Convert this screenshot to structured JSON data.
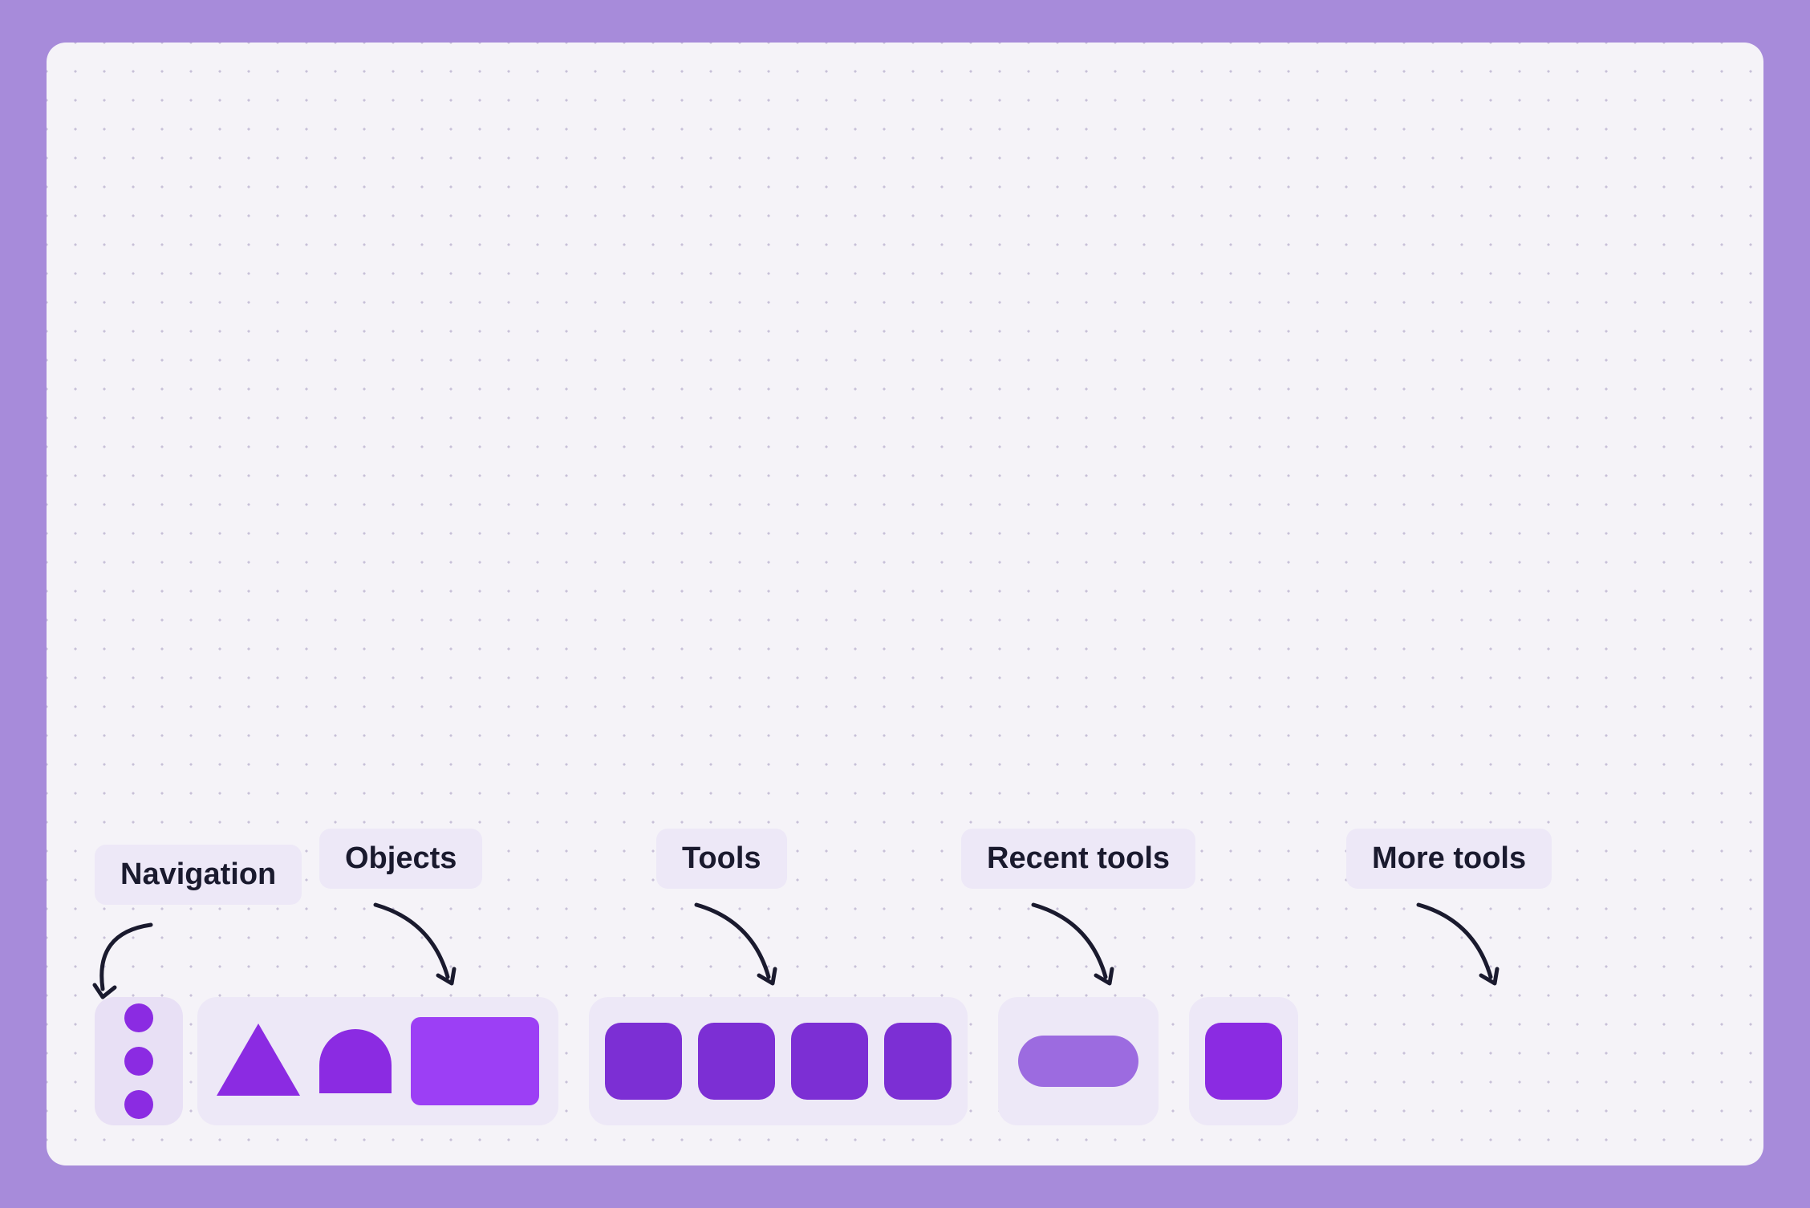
{
  "canvas": {
    "background": "#f5f3f8",
    "dot_color": "#c8c0d8"
  },
  "labels": {
    "navigation": "Navigation",
    "objects": "Objects",
    "tools": "Tools",
    "recent_tools": "Recent tools",
    "more_tools": "More tools"
  },
  "toolbar": {
    "nav_dots": 3,
    "shapes": [
      "triangle",
      "arch",
      "rectangle"
    ],
    "tools": [
      "square1",
      "square2",
      "square3",
      "square4"
    ],
    "recent": [
      "pill"
    ],
    "more": [
      "square"
    ]
  }
}
